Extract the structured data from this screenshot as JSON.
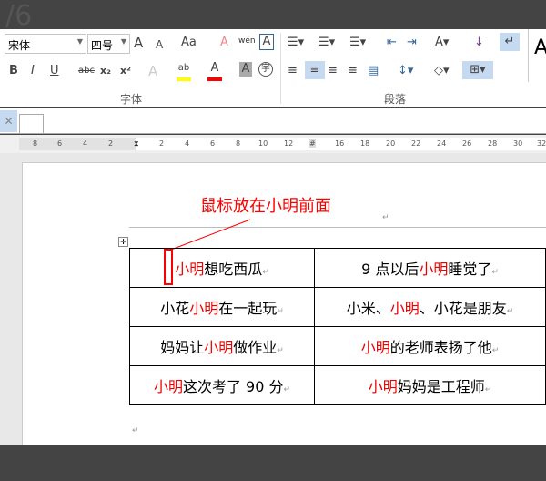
{
  "top": {
    "ghost_text": "/6"
  },
  "ribbon": {
    "font_name": "宋体",
    "font_size": "四号",
    "font_group_label": "字体",
    "paragraph_group_label": "段落",
    "buttons": {
      "grow": "A",
      "shrink": "A",
      "case": "Aa",
      "clear": "A",
      "phonetic": "wén",
      "border_char": "A",
      "bold": "B",
      "italic": "I",
      "underline": "U",
      "strike": "abc",
      "sub": "x₂",
      "sup": "x²",
      "effects": "A",
      "highlight": "ab",
      "color": "A",
      "shade": "A",
      "enclose": "字",
      "style_preview": "A"
    },
    "colors": {
      "highlight": "#ffff00",
      "font_color": "#ff0000",
      "active": "#c5d9f1"
    }
  },
  "ruler": {
    "ticks": [
      "8",
      "6",
      "4",
      "2",
      "2",
      "4",
      "6",
      "8",
      "10",
      "12",
      "16",
      "18",
      "20",
      "22",
      "24",
      "26",
      "28",
      "30",
      "32"
    ]
  },
  "annotation": {
    "text": "鼠标放在小明前面",
    "color": "#ff0000"
  },
  "table": {
    "rows": [
      [
        {
          "pre": "",
          "red": "小明",
          "post": "想吃西瓜"
        },
        {
          "pre": "9 点以后",
          "red": "小明",
          "post": "睡觉了"
        }
      ],
      [
        {
          "pre": "小花",
          "red": "小明",
          "post": "在一起玩"
        },
        {
          "pre": "小米、",
          "red": "小明",
          "post": "、小花是朋友"
        }
      ],
      [
        {
          "pre": "妈妈让",
          "red": "小明",
          "post": "做作业"
        },
        {
          "pre": "",
          "red": "小明",
          "post": "的老师表扬了他"
        }
      ],
      [
        {
          "pre": "",
          "red": "小明",
          "post": "这次考了 90 分"
        },
        {
          "pre": "",
          "red": "小明",
          "post": "妈妈是工程师"
        }
      ]
    ]
  },
  "paragraph_mark": "↵"
}
